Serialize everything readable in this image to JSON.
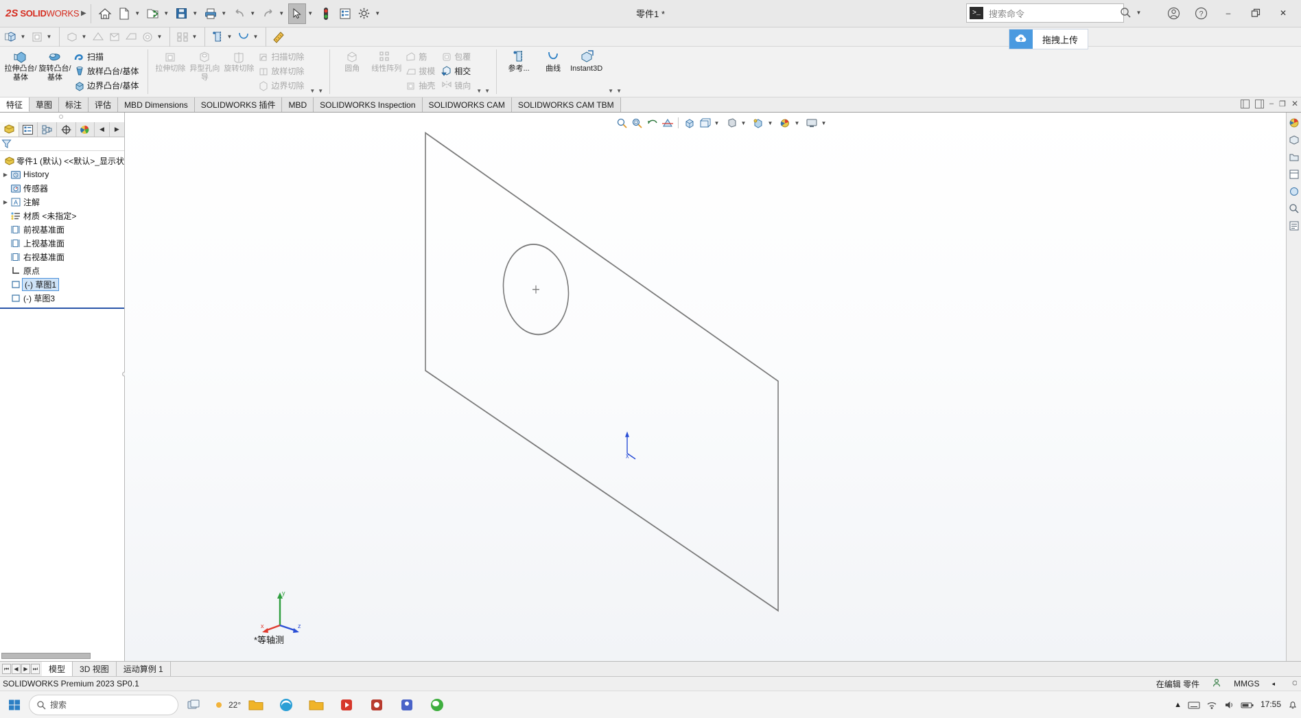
{
  "app": {
    "brand_mark": "2S",
    "brand_solid": "SOLID",
    "brand_works": "WORKS",
    "document_title": "零件1 *",
    "accent_red": "#d52b1e",
    "accent_blue": "#2a55a8"
  },
  "titlebar": {
    "buttons": [
      {
        "name": "home-button",
        "icon": "home-icon"
      },
      {
        "name": "new-document-button",
        "icon": "new-file-icon"
      },
      {
        "name": "open-document-button",
        "icon": "open-folder-icon"
      },
      {
        "name": "save-button",
        "icon": "save-floppy-icon"
      },
      {
        "name": "print-button",
        "icon": "printer-icon"
      },
      {
        "name": "undo-button",
        "icon": "undo-arrow-icon"
      },
      {
        "name": "redo-button",
        "icon": "redo-arrow-icon"
      },
      {
        "name": "select-tool-button",
        "icon": "cursor-arrow-icon"
      },
      {
        "name": "rebuild-button",
        "icon": "traffic-light-icon"
      },
      {
        "name": "file-properties-button",
        "icon": "properties-list-icon"
      },
      {
        "name": "options-button",
        "icon": "gear-icon"
      }
    ],
    "search": {
      "placeholder": "搜索命令",
      "prompt_glyph": ">_"
    },
    "account_icon": "user-circle-icon",
    "help_icon": "question-circle-icon",
    "minimize": "–",
    "restore": "❐",
    "close": "✕"
  },
  "drag_upload": {
    "label": "拖拽上传",
    "icon": "cloud-upload-icon",
    "color": "#4a9ae0"
  },
  "toolbar2": {
    "items": [
      "isometric-view-icon",
      "hidden-lines-icon",
      "shaded-icon",
      "section-view-icon",
      "display-style-icon",
      "view-orientation-icon",
      "apply-scene-icon",
      "viewport-icon",
      "view-settings-icon",
      "reference-geometry-icon",
      "curves-icon",
      "measure-icon"
    ]
  },
  "ribbon": {
    "groups": [
      {
        "big": [
          {
            "label": "拉伸凸台/基体",
            "icon": "extrude-boss-icon",
            "disabled": false,
            "name": "extruded-boss-base-button"
          },
          {
            "label": "旋转凸台/基体",
            "icon": "revolve-boss-icon",
            "disabled": false,
            "name": "revolved-boss-base-button"
          }
        ],
        "small": [
          {
            "label": "扫描",
            "icon": "sweep-icon",
            "disabled": false,
            "name": "swept-boss-base-button"
          },
          {
            "label": "放样凸台/基体",
            "icon": "loft-icon",
            "disabled": false,
            "name": "lofted-boss-base-button"
          },
          {
            "label": "边界凸台/基体",
            "icon": "boundary-boss-icon",
            "disabled": false,
            "name": "boundary-boss-base-button"
          }
        ]
      },
      {
        "big": [
          {
            "label": "拉伸切除",
            "icon": "extrude-cut-icon",
            "disabled": true,
            "name": "extruded-cut-button"
          },
          {
            "label": "异型孔向导",
            "icon": "hole-wizard-icon",
            "disabled": true,
            "name": "hole-wizard-button"
          },
          {
            "label": "旋转切除",
            "icon": "revolve-cut-icon",
            "disabled": true,
            "name": "revolved-cut-button"
          }
        ],
        "small": [
          {
            "label": "扫描切除",
            "icon": "swept-cut-icon",
            "disabled": true,
            "name": "swept-cut-button"
          },
          {
            "label": "放样切除",
            "icon": "lofted-cut-icon",
            "disabled": true,
            "name": "lofted-cut-button"
          },
          {
            "label": "边界切除",
            "icon": "boundary-cut-icon",
            "disabled": true,
            "name": "boundary-cut-button"
          }
        ]
      },
      {
        "big": [
          {
            "label": "圆角",
            "icon": "fillet-icon",
            "disabled": true,
            "name": "fillet-button"
          },
          {
            "label": "线性阵列",
            "icon": "linear-pattern-icon",
            "disabled": true,
            "name": "linear-pattern-button"
          }
        ],
        "small": [
          {
            "label": "筋",
            "icon": "rib-icon",
            "disabled": true,
            "name": "rib-button"
          },
          {
            "label": "拔模",
            "icon": "draft-icon",
            "disabled": true,
            "name": "draft-button"
          },
          {
            "label": "抽壳",
            "icon": "shell-icon",
            "disabled": true,
            "name": "shell-button"
          }
        ],
        "small2": [
          {
            "label": "包覆",
            "icon": "wrap-icon",
            "disabled": true,
            "name": "wrap-button"
          },
          {
            "label": "相交",
            "icon": "intersect-icon",
            "disabled": false,
            "name": "intersect-button"
          },
          {
            "label": "镜向",
            "icon": "mirror-icon",
            "disabled": true,
            "name": "mirror-button"
          }
        ]
      },
      {
        "big": [
          {
            "label": "参考...",
            "icon": "reference-geometry-icon",
            "disabled": false,
            "name": "reference-geometry-button"
          },
          {
            "label": "曲线",
            "icon": "curves-icon",
            "disabled": false,
            "name": "curves-button"
          }
        ],
        "small": [
          {
            "label": "Instant3D",
            "icon": "instant3d-icon",
            "disabled": false,
            "name": "instant3d-button"
          }
        ]
      }
    ]
  },
  "tabs": {
    "items": [
      {
        "label": "特征",
        "active": true,
        "name": "tab-features"
      },
      {
        "label": "草图",
        "active": false,
        "name": "tab-sketch"
      },
      {
        "label": "标注",
        "active": false,
        "name": "tab-markup"
      },
      {
        "label": "评估",
        "active": false,
        "name": "tab-evaluate"
      },
      {
        "label": "MBD Dimensions",
        "active": false,
        "name": "tab-mbd-dimensions"
      },
      {
        "label": "SOLIDWORKS 插件",
        "active": false,
        "name": "tab-solidworks-addins"
      },
      {
        "label": "MBD",
        "active": false,
        "name": "tab-mbd"
      },
      {
        "label": "SOLIDWORKS Inspection",
        "active": false,
        "name": "tab-solidworks-inspection"
      },
      {
        "label": "SOLIDWORKS CAM",
        "active": false,
        "name": "tab-solidworks-cam"
      },
      {
        "label": "SOLIDWORKS CAM TBM",
        "active": false,
        "name": "tab-solidworks-cam-tbm"
      }
    ]
  },
  "feature_tree": {
    "panel_tabs": [
      {
        "name": "tree-tab-feature-manager",
        "icon": "feature-manager-icon",
        "active": true
      },
      {
        "name": "tree-tab-property-manager",
        "icon": "property-manager-icon",
        "active": false
      },
      {
        "name": "tree-tab-configuration-manager",
        "icon": "configuration-manager-icon",
        "active": false
      },
      {
        "name": "tree-tab-dimxpert-manager",
        "icon": "dimxpert-icon",
        "active": false
      },
      {
        "name": "tree-tab-display-manager",
        "icon": "display-manager-icon",
        "active": false
      }
    ],
    "filter_icon": "filter-funnel-icon",
    "root": "零件1 (默认) <<默认>_显示状",
    "nodes": [
      {
        "label": "History",
        "icon": "history-icon",
        "expandable": true,
        "selected": false,
        "name": "tree-node-history"
      },
      {
        "label": "传感器",
        "icon": "sensors-icon",
        "expandable": false,
        "selected": false,
        "name": "tree-node-sensors"
      },
      {
        "label": "注解",
        "icon": "annotations-icon",
        "expandable": true,
        "selected": false,
        "name": "tree-node-annotations"
      },
      {
        "label": "材质 <未指定>",
        "icon": "material-icon",
        "expandable": false,
        "selected": false,
        "name": "tree-node-material"
      },
      {
        "label": "前视基准面",
        "icon": "plane-icon",
        "expandable": false,
        "selected": false,
        "name": "tree-node-front-plane"
      },
      {
        "label": "上视基准面",
        "icon": "plane-icon",
        "expandable": false,
        "selected": false,
        "name": "tree-node-top-plane"
      },
      {
        "label": "右视基准面",
        "icon": "plane-icon",
        "expandable": false,
        "selected": false,
        "name": "tree-node-right-plane"
      },
      {
        "label": "原点",
        "icon": "origin-icon",
        "expandable": false,
        "selected": false,
        "name": "tree-node-origin"
      },
      {
        "label": "(-) 草图1",
        "icon": "sketch-icon",
        "expandable": false,
        "selected": true,
        "name": "tree-node-sketch1"
      },
      {
        "label": "(-) 草图3",
        "icon": "sketch-icon",
        "expandable": false,
        "selected": false,
        "name": "tree-node-sketch3"
      }
    ]
  },
  "graphics": {
    "view_label": "*等轴测",
    "view_toolbar": [
      "zoom-to-fit-icon",
      "zoom-to-area-icon",
      "previous-view-icon",
      "section-view-icon",
      "view-orientation-icon",
      "display-style-icon",
      "hide-show-items-icon",
      "edit-appearance-icon",
      "apply-scene-icon",
      "view-settings-icon"
    ],
    "triad_labels": {
      "x": "x",
      "y": "y",
      "z": "z"
    },
    "sketch": {
      "outline_color": "#7a7a7a",
      "circle_center_marker": "+"
    }
  },
  "right_dock": {
    "items": [
      "appearances-icon",
      "scenes-icon",
      "decals-icon",
      "lights-icon",
      "design-library-icon",
      "file-explorer-icon",
      "search-icon",
      "view-palette-icon",
      "appearance-palette-icon"
    ]
  },
  "bottom_tabs": {
    "nav": [
      "⏮",
      "◀",
      "▶",
      "⏭"
    ],
    "items": [
      {
        "label": "模型",
        "active": true,
        "name": "bottom-tab-model"
      },
      {
        "label": "3D 视图",
        "active": false,
        "name": "bottom-tab-3d-views"
      },
      {
        "label": "运动算例 1",
        "active": false,
        "name": "bottom-tab-motion-study-1"
      }
    ]
  },
  "statusbar": {
    "left": "SOLIDWORKS Premium 2023 SP0.1",
    "editing": "在编辑 零件",
    "units": "MMGS",
    "person_icon": "editing-person-icon",
    "units_caret": "◂"
  },
  "taskbar": {
    "start_icon": "windows-start-icon",
    "search_placeholder": "搜索",
    "search_icon": "search-icon",
    "weather_temp": "22°",
    "apps": [
      "task-view-icon",
      "file-explorer-icon",
      "edge-browser-icon",
      "folder-icon",
      "media-player-icon",
      "recorder-icon",
      "teams-icon",
      "wechat-icon"
    ],
    "tray_icons": [
      "chevron-up-icon",
      "keyboard-icon",
      "network-icon",
      "volume-icon",
      "battery-icon"
    ],
    "clock_time": "17:55",
    "clock_date": "",
    "notification_icon": "notification-bell-icon"
  }
}
